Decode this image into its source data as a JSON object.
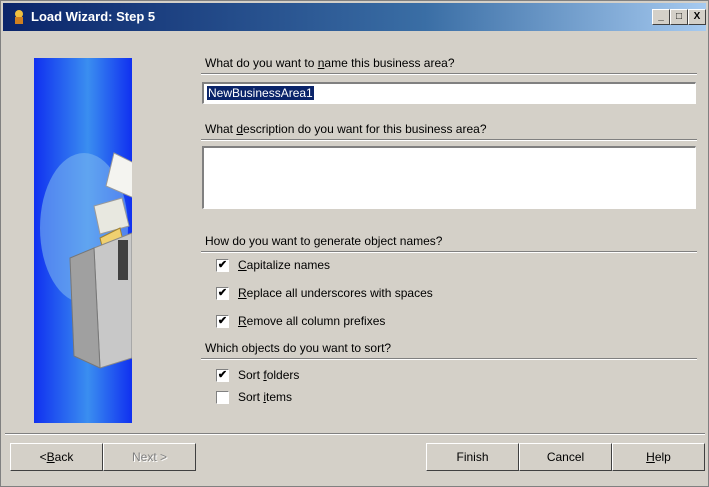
{
  "window": {
    "title": "Load Wizard: Step 5",
    "controls": {
      "minimize": "_",
      "maximize": "□",
      "close": "X"
    }
  },
  "form": {
    "name_q": {
      "pre": "What do you want to ",
      "key": "n",
      "post": "ame this business area?"
    },
    "name_value": "NewBusinessArea1",
    "desc_q": {
      "pre": "What ",
      "key": "d",
      "post": "escription do you want for this business area?"
    },
    "desc_value": "",
    "gen_q": "How do you want to generate object names?",
    "gen_options": [
      {
        "key": "C",
        "rest": "apitalize names",
        "checked": true
      },
      {
        "key": "R",
        "rest": "eplace all underscores with spaces",
        "checked": true
      },
      {
        "key": "R",
        "rest": "emove all column prefixes",
        "checked": true
      }
    ],
    "sort_q": "Which objects do you want to sort?",
    "sort_options": [
      {
        "pre": "Sort ",
        "key": "f",
        "rest": "olders",
        "checked": true
      },
      {
        "pre": "Sort ",
        "key": "i",
        "rest": "tems",
        "checked": false
      }
    ]
  },
  "buttons": {
    "back": {
      "pre": "< ",
      "key": "B",
      "post": "ack"
    },
    "next": "Next >",
    "finish": "Finish",
    "cancel": "Cancel",
    "help": {
      "key": "H",
      "post": "elp"
    }
  },
  "colors": {
    "titlebar": "#0a246a",
    "selection": "#0a246a",
    "side_image": "#1030f0"
  },
  "icons": [
    "wizard-app-icon",
    "wizard-box-illustration",
    "checkmark-icon"
  ]
}
